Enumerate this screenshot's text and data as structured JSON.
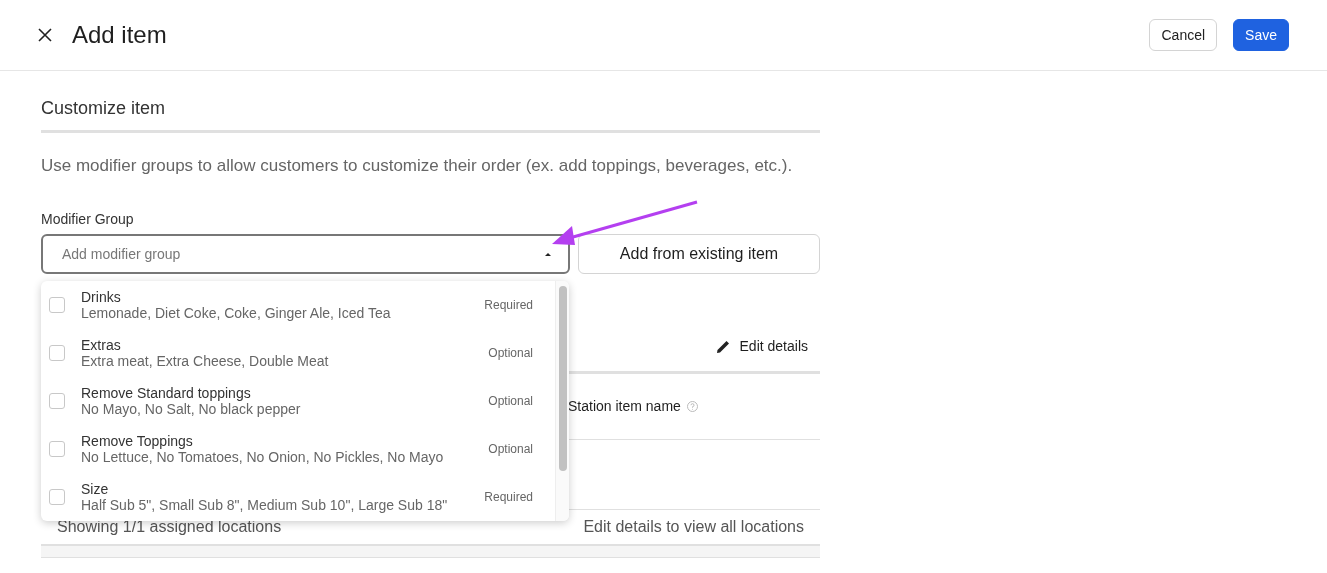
{
  "header": {
    "title": "Add item",
    "buttons": [
      {
        "label": "Cancel",
        "kind": "secondary"
      },
      {
        "label": "Save",
        "kind": "primary"
      }
    ]
  },
  "section": {
    "title": "Customize item",
    "description": "Use modifier groups to allow customers to customize their order (ex. add toppings, beverages, etc.)."
  },
  "modifier_group": {
    "label": "Modifier Group",
    "placeholder": "Add modifier group",
    "expanded": true,
    "add_button": "Add from existing item"
  },
  "options": [
    {
      "name": "Drinks",
      "items": "Lemonade, Diet Coke, Coke, Ginger Ale, Iced Tea",
      "requirement": "Required",
      "checked": false
    },
    {
      "name": "Extras",
      "items": "Extra meat, Extra Cheese, Double Meat",
      "requirement": "Optional",
      "checked": false
    },
    {
      "name": "Remove Standard toppings",
      "items": "No Mayo, No Salt, No black pepper",
      "requirement": "Optional",
      "checked": false
    },
    {
      "name": "Remove Toppings",
      "items": "No Lettuce, No Tomatoes, No Onion, No Pickles, No Mayo",
      "requirement": "Optional",
      "checked": false
    },
    {
      "name": "Size",
      "items": "Half Sub 5\", Small Sub 8\", Medium Sub 10\", Large Sub 18\"",
      "requirement": "Required",
      "checked": false
    }
  ],
  "locations": {
    "edit_button": "Edit details",
    "column": "Station item name",
    "footer_left": "Showing 1/1 assigned locations",
    "footer_right": "Edit details to view all locations"
  }
}
